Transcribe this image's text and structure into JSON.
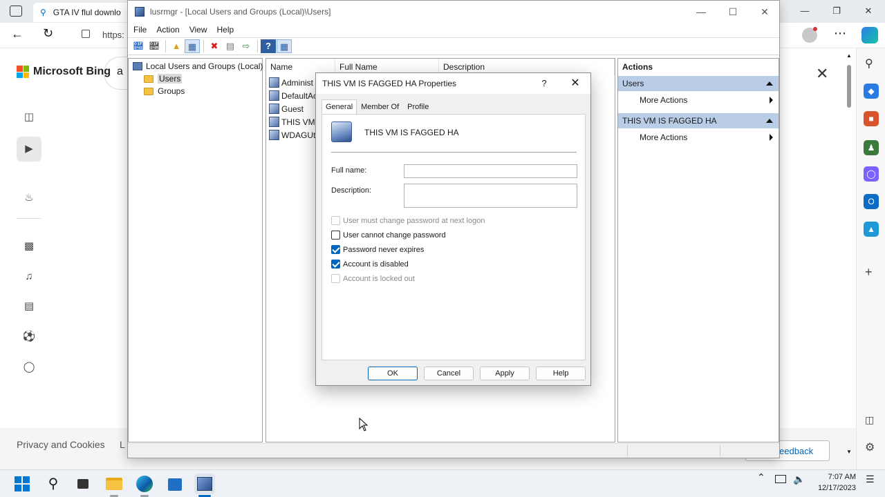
{
  "browser": {
    "tab_title": "GTA IV flul downlo",
    "address_partial": "https:",
    "bing_logo": "Microsoft Bing",
    "search_partial": "a",
    "footer_privacy": "Privacy and Cookies",
    "footer_partial": "L",
    "feedback_partial": "eedback"
  },
  "mmc": {
    "title": "lusrmgr - [Local Users and Groups (Local)\\Users]",
    "menu": [
      "File",
      "Action",
      "View",
      "Help"
    ],
    "tree": {
      "root": "Local Users and Groups (Local)",
      "users": "Users",
      "groups": "Groups"
    },
    "columns": [
      "Name",
      "Full Name",
      "Description"
    ],
    "rows": [
      "Administ",
      "DefaultAc",
      "Guest",
      "THIS VM I",
      "WDAGUti"
    ],
    "actions": {
      "header": "Actions",
      "section1": "Users",
      "more1": "More Actions",
      "section2": "THIS VM IS FAGGED HA",
      "more2": "More Actions"
    }
  },
  "dialog": {
    "title": "THIS VM IS FAGGED HA Properties",
    "help_glyph": "?",
    "tabs": [
      "General",
      "Member Of",
      "Profile"
    ],
    "username": "THIS VM IS FAGGED HA",
    "fullname_label": "Full name:",
    "fullname_value": "",
    "description_label": "Description:",
    "description_value": "",
    "checkboxes": [
      {
        "label": "User must change password at next logon",
        "checked": false,
        "enabled": false
      },
      {
        "label": "User cannot change password",
        "checked": false,
        "enabled": true
      },
      {
        "label": "Password never expires",
        "checked": true,
        "enabled": true
      },
      {
        "label": "Account is disabled",
        "checked": true,
        "enabled": true
      },
      {
        "label": "Account is locked out",
        "checked": false,
        "enabled": false
      }
    ],
    "buttons": {
      "ok": "OK",
      "cancel": "Cancel",
      "apply": "Apply",
      "help": "Help"
    }
  },
  "taskbar": {
    "time": "7:07 AM",
    "date": "12/17/2023"
  }
}
